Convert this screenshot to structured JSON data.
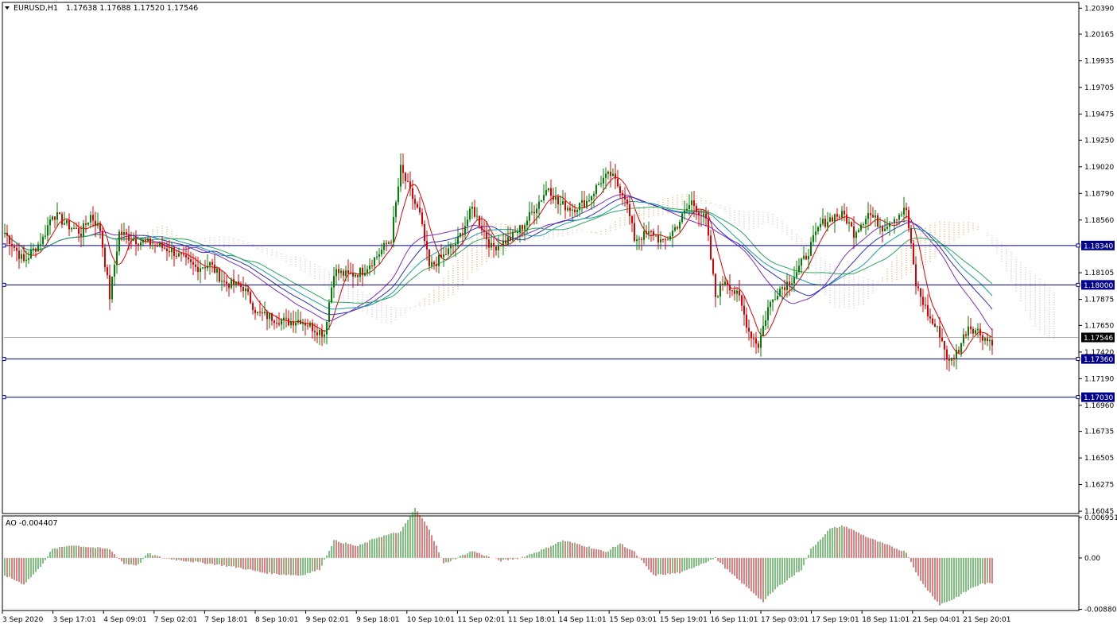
{
  "header": {
    "symbol": "EURUSD,H1",
    "ohlc": "1.17638 1.17688 1.17520 1.17546"
  },
  "ao_panel": {
    "title": "AO -0.004407"
  },
  "colors": {
    "bull_candle": "#008000",
    "bear_candle": "#e00000",
    "level_line": "#00008b",
    "ma_red": "#e00000",
    "ma_purple": "#7a2fd0",
    "ma_blue": "#3030c0",
    "ma_teal": "#14a0a0",
    "ma_green": "#2aa85a",
    "cloud_pink": "#d8a0e0",
    "cloud_orange": "#f08a30",
    "ao_up": "#008000",
    "ao_down": "#c00000"
  },
  "chart_data": [
    {
      "type": "candlestick",
      "title": "EURUSD,H1",
      "price_axis_ticks": [
        "1.20390",
        "1.20165",
        "1.19935",
        "1.19705",
        "1.19475",
        "1.19250",
        "1.19020",
        "1.18790",
        "1.18560",
        "1.18105",
        "1.17875",
        "1.17650",
        "1.17420",
        "1.17190",
        "1.16960",
        "1.16735",
        "1.16505",
        "1.16275",
        "1.16045"
      ],
      "ylim": [
        1.16025,
        1.2044
      ],
      "time_axis_labels": [
        "3 Sep 2020",
        "3 Sep 17:01",
        "4 Sep 09:01",
        "7 Sep 02:01",
        "7 Sep 18:01",
        "8 Sep 10:01",
        "9 Sep 02:01",
        "9 Sep 18:01",
        "10 Sep 10:01",
        "11 Sep 02:01",
        "11 Sep 18:01",
        "14 Sep 11:01",
        "15 Sep 03:01",
        "15 Sep 19:01",
        "16 Sep 11:01",
        "17 Sep 03:01",
        "17 Sep 19:01",
        "18 Sep 11:01",
        "21 Sep 04:01",
        "21 Sep 20:01"
      ],
      "horizontal_levels": [
        {
          "label": "1.18340",
          "value": 1.1834
        },
        {
          "label": "1.18000",
          "value": 1.18
        },
        {
          "label": "1.17360",
          "value": 1.1736
        },
        {
          "label": "1.17030",
          "value": 1.1703
        }
      ],
      "current_price": {
        "label": "1.17546",
        "value": 1.17546
      },
      "close_path": [
        [
          0,
          1.1845
        ],
        [
          8,
          1.182
        ],
        [
          16,
          1.184
        ],
        [
          20,
          1.1862
        ],
        [
          26,
          1.1852
        ],
        [
          32,
          1.1845
        ],
        [
          36,
          1.186
        ],
        [
          40,
          1.1848
        ],
        [
          44,
          1.179
        ],
        [
          48,
          1.1845
        ],
        [
          56,
          1.1838
        ],
        [
          62,
          1.1835
        ],
        [
          70,
          1.183
        ],
        [
          76,
          1.182
        ],
        [
          80,
          1.1815
        ],
        [
          86,
          1.1818
        ],
        [
          92,
          1.1802
        ],
        [
          100,
          1.1798
        ],
        [
          106,
          1.1775
        ],
        [
          112,
          1.1772
        ],
        [
          118,
          1.1768
        ],
        [
          124,
          1.177
        ],
        [
          130,
          1.1762
        ],
        [
          134,
          1.1758
        ],
        [
          138,
          1.1812
        ],
        [
          144,
          1.1808
        ],
        [
          150,
          1.1812
        ],
        [
          156,
          1.1825
        ],
        [
          162,
          1.184
        ],
        [
          166,
          1.19
        ],
        [
          170,
          1.188
        ],
        [
          174,
          1.186
        ],
        [
          178,
          1.1815
        ],
        [
          184,
          1.1825
        ],
        [
          190,
          1.1838
        ],
        [
          196,
          1.1866
        ],
        [
          200,
          1.185
        ],
        [
          204,
          1.1832
        ],
        [
          212,
          1.184
        ],
        [
          218,
          1.1853
        ],
        [
          224,
          1.1872
        ],
        [
          228,
          1.1885
        ],
        [
          232,
          1.187
        ],
        [
          238,
          1.1866
        ],
        [
          244,
          1.1872
        ],
        [
          250,
          1.189
        ],
        [
          254,
          1.1895
        ],
        [
          260,
          1.1877
        ],
        [
          264,
          1.184
        ],
        [
          272,
          1.1845
        ],
        [
          276,
          1.1835
        ],
        [
          282,
          1.1852
        ],
        [
          288,
          1.1872
        ],
        [
          294,
          1.1855
        ],
        [
          298,
          1.179
        ],
        [
          302,
          1.1805
        ],
        [
          308,
          1.1788
        ],
        [
          312,
          1.176
        ],
        [
          316,
          1.1748
        ],
        [
          320,
          1.178
        ],
        [
          324,
          1.1795
        ],
        [
          330,
          1.1805
        ],
        [
          336,
          1.1825
        ],
        [
          342,
          1.1852
        ],
        [
          348,
          1.186
        ],
        [
          352,
          1.186
        ],
        [
          356,
          1.1845
        ],
        [
          362,
          1.1862
        ],
        [
          368,
          1.185
        ],
        [
          374,
          1.186
        ],
        [
          378,
          1.1865
        ],
        [
          382,
          1.18
        ],
        [
          388,
          1.177
        ],
        [
          392,
          1.1758
        ],
        [
          396,
          1.1732
        ],
        [
          400,
          1.1745
        ],
        [
          404,
          1.1765
        ],
        [
          408,
          1.176
        ],
        [
          412,
          1.1752
        ]
      ]
    },
    {
      "type": "bar",
      "title": "AO -0.004407",
      "axis_ticks": [
        "0.006951",
        "0.00",
        "-0.008802"
      ],
      "ylim": [
        -0.009,
        0.0072
      ],
      "value_path": [
        [
          0,
          -0.003
        ],
        [
          8,
          -0.0045
        ],
        [
          14,
          -0.002
        ],
        [
          20,
          0.0015
        ],
        [
          28,
          0.0022
        ],
        [
          44,
          0.0015
        ],
        [
          50,
          -0.001
        ],
        [
          56,
          -0.0012
        ],
        [
          60,
          0.0008
        ],
        [
          66,
          0.0
        ],
        [
          76,
          -0.0005
        ],
        [
          90,
          -0.0012
        ],
        [
          100,
          -0.0018
        ],
        [
          108,
          -0.0025
        ],
        [
          116,
          -0.0028
        ],
        [
          124,
          -0.003
        ],
        [
          132,
          -0.002
        ],
        [
          138,
          0.003
        ],
        [
          148,
          0.002
        ],
        [
          156,
          0.0035
        ],
        [
          166,
          0.0045
        ],
        [
          172,
          0.0085
        ],
        [
          178,
          0.005
        ],
        [
          184,
          -0.001
        ],
        [
          196,
          0.0012
        ],
        [
          208,
          -0.0005
        ],
        [
          216,
          0.0
        ],
        [
          226,
          0.0015
        ],
        [
          234,
          0.003
        ],
        [
          244,
          0.002
        ],
        [
          252,
          0.001
        ],
        [
          258,
          0.0025
        ],
        [
          264,
          0.001
        ],
        [
          272,
          -0.003
        ],
        [
          284,
          -0.0025
        ],
        [
          292,
          -0.001
        ],
        [
          298,
          0.0
        ],
        [
          304,
          -0.0025
        ],
        [
          314,
          -0.006
        ],
        [
          318,
          -0.0075
        ],
        [
          324,
          -0.005
        ],
        [
          334,
          -0.002
        ],
        [
          338,
          0.0015
        ],
        [
          346,
          0.005
        ],
        [
          352,
          0.0055
        ],
        [
          362,
          0.0035
        ],
        [
          368,
          0.0025
        ],
        [
          378,
          0.001
        ],
        [
          384,
          -0.004
        ],
        [
          392,
          -0.008
        ],
        [
          398,
          -0.007
        ],
        [
          406,
          -0.005
        ],
        [
          410,
          -0.0044
        ]
      ]
    }
  ]
}
